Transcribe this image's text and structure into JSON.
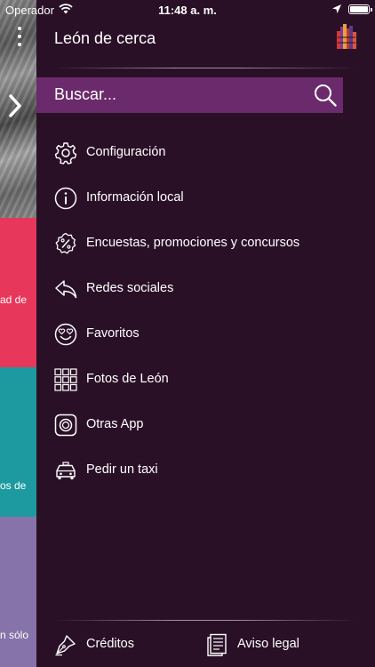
{
  "status_bar": {
    "carrier": "Operador",
    "time": "11:48 a. m.",
    "icons": [
      "wifi-icon",
      "location-arrow-icon",
      "battery-icon"
    ]
  },
  "background": {
    "pink_text": "ad de",
    "teal_text": "os de",
    "purple_text": "n sólo",
    "colors": {
      "pink": "#e7375a",
      "teal": "#1d9aa0",
      "purple": "#8573a9"
    }
  },
  "drawer": {
    "title": "León de cerca",
    "search": {
      "placeholder": "Buscar..."
    },
    "menu": [
      {
        "label": "Configuración",
        "icon": "gear-icon"
      },
      {
        "label": "Información local",
        "icon": "info-icon"
      },
      {
        "label": "Encuestas, promociones y concursos",
        "icon": "percent-icon"
      },
      {
        "label": "Redes sociales",
        "icon": "reply-arrow-icon"
      },
      {
        "label": "Favoritos",
        "icon": "heart-eyes-icon"
      },
      {
        "label": "Fotos de León",
        "icon": "grid-icon"
      },
      {
        "label": "Otras App",
        "icon": "app-icon"
      },
      {
        "label": "Pedir un taxi",
        "icon": "taxi-icon"
      }
    ],
    "footer": [
      {
        "label": "Créditos",
        "icon": "pen-nib-icon"
      },
      {
        "label": "Aviso legal",
        "icon": "document-icon"
      }
    ],
    "colors": {
      "background": "#2a1027",
      "search_bar": "#6a2a6b",
      "text": "#ffffff"
    }
  }
}
